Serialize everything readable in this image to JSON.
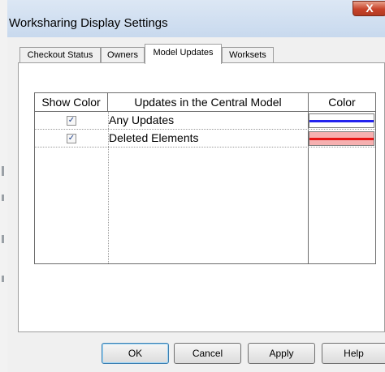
{
  "window": {
    "title": "Worksharing Display Settings",
    "close_symbol": "X"
  },
  "tabs": [
    {
      "label": "Checkout Status",
      "active": false
    },
    {
      "label": "Owners",
      "active": false
    },
    {
      "label": "Model Updates",
      "active": true
    },
    {
      "label": "Worksets",
      "active": false
    }
  ],
  "table": {
    "headers": [
      "Show Color",
      "Updates in the Central Model",
      "Color"
    ],
    "rows": [
      {
        "checked": true,
        "check_symbol": "✓",
        "label": "Any Updates",
        "color": "#2323ee",
        "fill": "#ffffff"
      },
      {
        "checked": true,
        "check_symbol": "✓",
        "label": "Deleted Elements",
        "color": "#e81414",
        "fill": "#f6b0b0"
      }
    ]
  },
  "buttons": {
    "ok": "OK",
    "cancel": "Cancel",
    "apply": "Apply",
    "help": "Help"
  }
}
